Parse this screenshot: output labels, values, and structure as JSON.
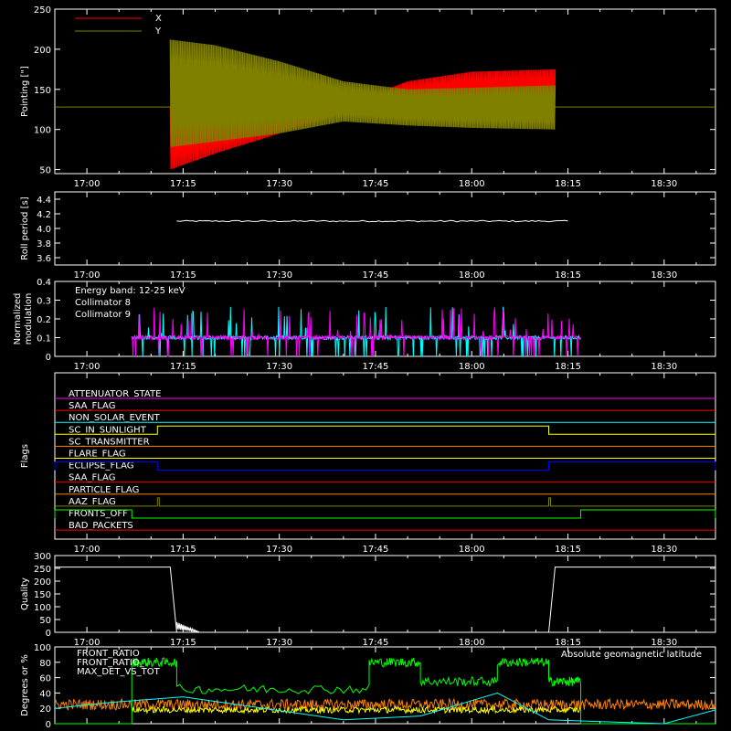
{
  "time_ticks": [
    "17:00",
    "17:15",
    "17:30",
    "17:45",
    "18:00",
    "18:15",
    "18:30"
  ],
  "colors": {
    "background": "#000000",
    "axes": "#ffffff",
    "x_series": "#ff0000",
    "y_series": "#808000",
    "collimator8": "#00ffff",
    "collimator9": "#ff00ff",
    "front_ratio_yellow": "#ffff00",
    "front_ratio_green": "#00ff00",
    "max_det": "#ff8000",
    "geomag": "#00ffff"
  },
  "chart_data": [
    {
      "type": "line",
      "ylabel": "Pointing [\"]",
      "ylim": [
        45,
        250
      ],
      "yticks": [
        "50",
        "100",
        "150",
        "200",
        "250"
      ],
      "legend": [
        "X",
        "Y"
      ],
      "series": [
        {
          "name": "X",
          "x": [
            "17:13",
            "17:20",
            "17:30",
            "17:40",
            "17:50",
            "18:00",
            "18:13"
          ],
          "y_min": [
            50,
            70,
            95,
            120,
            122,
            120,
            120
          ],
          "y_max": [
            130,
            128,
            128,
            130,
            160,
            172,
            175
          ]
        },
        {
          "name": "Y",
          "x": [
            "17:13",
            "17:20",
            "17:30",
            "17:40",
            "17:50",
            "18:00",
            "18:13"
          ],
          "y_min": [
            78,
            85,
            95,
            110,
            105,
            102,
            100
          ],
          "y_max": [
            212,
            205,
            185,
            160,
            150,
            152,
            155
          ]
        }
      ],
      "baseline": 128
    },
    {
      "type": "line",
      "ylabel": "Roll period [s]",
      "ylim": [
        3.5,
        4.5
      ],
      "yticks": [
        "3.6",
        "3.8",
        "4.0",
        "4.2",
        "4.4"
      ],
      "series": [
        {
          "x": [
            "17:14",
            "18:15"
          ],
          "y": [
            4.1,
            4.1
          ]
        }
      ]
    },
    {
      "type": "line",
      "ylabel": "Normalized modulation",
      "ylim": [
        0,
        0.4
      ],
      "yticks": [
        "0",
        "0.1",
        "0.2",
        "0.3",
        "0.4"
      ],
      "annotation": "Energy band: 12-25 keV",
      "series": [
        {
          "name": "Collimator 8",
          "x": [
            "17:07",
            "18:17"
          ],
          "y_base": 0.1
        },
        {
          "name": "Collimator 9",
          "x": [
            "17:07",
            "18:17"
          ],
          "y_base": 0.1
        }
      ]
    },
    {
      "type": "flags",
      "ylabel": "Flags",
      "flags": [
        {
          "name": "ATTENUATOR_STATE",
          "color": "#ff00ff",
          "on": []
        },
        {
          "name": "SAA_FLAG",
          "color": "#ff0000",
          "on": []
        },
        {
          "name": "NON_SOLAR_EVENT",
          "color": "#00ffff",
          "on": []
        },
        {
          "name": "SC_IN_SUNLIGHT",
          "color": "#ffff00",
          "on": [
            [
              "17:11",
              "18:12"
            ]
          ]
        },
        {
          "name": "SC_TRANSMITTER",
          "color": "#ff8000",
          "on": []
        },
        {
          "name": "FLARE_FLAG",
          "color": "#ffff00",
          "on": []
        },
        {
          "name": "ECLIPSE_FLAG",
          "color": "#0000ff",
          "on": [
            [
              "16:55",
              "17:11"
            ],
            [
              "18:12",
              "18:38"
            ]
          ]
        },
        {
          "name": "SAA_FLAG",
          "color": "#ff0000",
          "on": []
        },
        {
          "name": "PARTICLE_FLAG",
          "color": "#ff8000",
          "on": []
        },
        {
          "name": "AAZ_FLAG",
          "color": "#808000",
          "on": [
            [
              "17:11",
              "17:11"
            ],
            [
              "18:12",
              "18:12"
            ]
          ]
        },
        {
          "name": "FRONTS_OFF",
          "color": "#00ff00",
          "on": [
            [
              "16:55",
              "17:07"
            ],
            [
              "18:17",
              "18:38"
            ]
          ]
        },
        {
          "name": "BAD_PACKETS",
          "color": "#ff0000",
          "on": []
        }
      ]
    },
    {
      "type": "line",
      "ylabel": "Quality",
      "ylim": [
        0,
        300
      ],
      "yticks": [
        "0",
        "50",
        "100",
        "150",
        "200",
        "250",
        "300"
      ],
      "series": [
        {
          "x": [
            "16:55",
            "17:13",
            "17:14",
            "18:12",
            "18:13",
            "18:38"
          ],
          "y": [
            255,
            255,
            0,
            0,
            255,
            255
          ]
        }
      ]
    },
    {
      "type": "line",
      "ylabel": "Degrees or %",
      "ylim": [
        0,
        100
      ],
      "yticks": [
        "0",
        "20",
        "40",
        "60",
        "80",
        "100"
      ],
      "legend": [
        "FRONT_RATIO",
        "FRONT_RATIO_",
        "MAX_DET_VS_TOT"
      ],
      "annotation": "Absolute geomagnetic latitude",
      "series": [
        {
          "name": "FRONT_RATIO",
          "color": "#ffff00",
          "y_base": 18
        },
        {
          "name": "FRONT_RATIO_",
          "color": "#00ff00",
          "x_segments": [
            [
              "17:07",
              "17:14",
              80
            ],
            [
              "17:14",
              "17:44",
              45
            ],
            [
              "17:44",
              "17:52",
              80
            ],
            [
              "17:52",
              "18:04",
              55
            ],
            [
              "18:04",
              "18:12",
              80
            ],
            [
              "18:12",
              "18:17",
              55
            ]
          ]
        },
        {
          "name": "MAX_DET_VS_TOT",
          "color": "#ff8000",
          "y_base": 25
        },
        {
          "name": "Absolute geomagnetic latitude",
          "color": "#00ffff",
          "x": [
            "16:55",
            "17:04",
            "17:15",
            "17:40",
            "17:52",
            "18:04",
            "18:12",
            "18:30",
            "18:38"
          ],
          "y": [
            20,
            28,
            35,
            5,
            10,
            40,
            5,
            0,
            18
          ]
        }
      ]
    }
  ]
}
